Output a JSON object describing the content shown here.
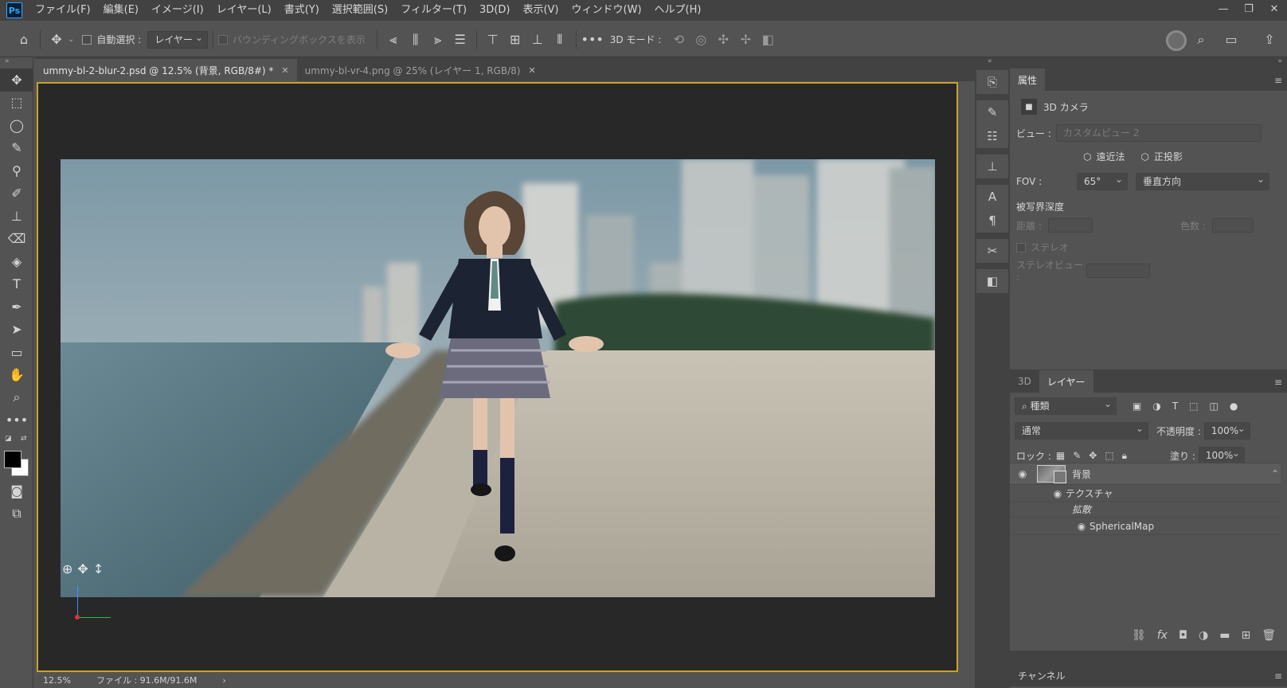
{
  "app": {
    "logo": "Ps",
    "menu": [
      "ファイル(F)",
      "編集(E)",
      "イメージ(I)",
      "レイヤー(L)",
      "書式(Y)",
      "選択範囲(S)",
      "フィルター(T)",
      "3D(D)",
      "表示(V)",
      "ウィンドウ(W)",
      "ヘルプ(H)"
    ],
    "window_controls": [
      "—",
      "❐",
      "✕"
    ]
  },
  "options_bar": {
    "auto_select_label": "自動選択 :",
    "auto_select_target": "レイヤー",
    "bounding_box_label": "バウンディングボックスを表示",
    "mode3d_label": "3D モード :",
    "more": "•••"
  },
  "tabs": [
    {
      "label": "ummy-bl-2-blur-2.psd @ 12.5% (背景, RGB/8#) *",
      "active": true
    },
    {
      "label": "ummy-bl-vr-4.png @ 25% (レイヤー 1, RGB/8)",
      "active": false
    }
  ],
  "status": {
    "zoom": "12.5%",
    "file_size": "ファイル : 91.6M/91.6M",
    "arrow": "›"
  },
  "properties": {
    "tab": "属性",
    "type_label": "3D カメラ",
    "view_label": "ビュー :",
    "view_value": "カスタムビュー 2",
    "perspective": "遠近法",
    "orthographic": "正投影",
    "fov_label": "FOV :",
    "fov_value": "65°",
    "fov_direction": "垂直方向",
    "dof_label": "被写界深度",
    "distance_label": "距離 :",
    "blur_label": "色数 :",
    "stereo_label": "ステレオ",
    "stereo_view_label": "ステレオビュー :"
  },
  "layers": {
    "tab_3d": "3D",
    "tab_layers": "レイヤー",
    "filter_kind": "種類",
    "blend_mode": "通常",
    "opacity_label": "不透明度 :",
    "opacity_value": "100%",
    "lock_label": "ロック :",
    "fill_label": "塗り :",
    "fill_value": "100%",
    "items": [
      {
        "name": "背景",
        "level": 0
      },
      {
        "name": "テクスチャ",
        "level": 1
      },
      {
        "name": "拡散",
        "level": 2
      },
      {
        "name": "SphericalMap",
        "level": 3
      }
    ]
  },
  "channels": {
    "tab": "チャンネル"
  },
  "colors": {
    "canvas_border": "#c9a32a",
    "foreground": "#000000",
    "background": "#ffffff"
  }
}
